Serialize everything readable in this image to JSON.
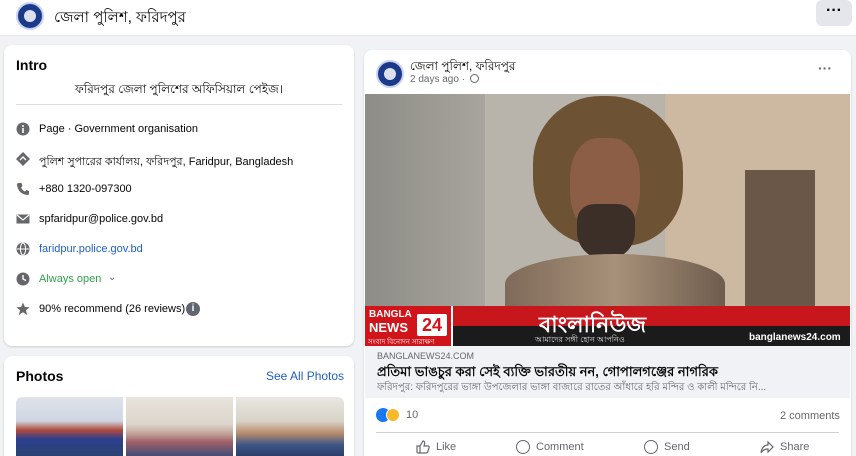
{
  "header": {
    "page_name": "জেলা পুলিশ, ফরিদপুর",
    "more_label": "···"
  },
  "intro": {
    "title": "Intro",
    "bio": "ফরিদপুর জেলা পুলিশের অফিসিয়াল পেইজ।",
    "items": [
      {
        "icon": "info-icon",
        "text": "Page · Government organisation"
      },
      {
        "icon": "location-pin-icon",
        "text": "পুলিশ সুপারের কার্যালয়, ফরিদপুর, Faridpur, Bangladesh"
      },
      {
        "icon": "phone-icon",
        "text": "+880 1320-097300"
      },
      {
        "icon": "email-icon",
        "text": "spfaridpur@police.gov.bd"
      },
      {
        "icon": "globe-icon",
        "text": "faridpur.police.gov.bd"
      },
      {
        "icon": "clock-icon",
        "text": "Always open",
        "chevron": "⌄"
      },
      {
        "icon": "star-icon",
        "text": "90% recommend (26 reviews)",
        "badge": "i"
      }
    ]
  },
  "photos": {
    "title": "Photos",
    "see_all": "See All Photos"
  },
  "post": {
    "author": "জেলা পুলিশ, ফরিদপুর",
    "time": "2 days ago ·",
    "more_label": "···",
    "image": {
      "brand_line1": "BANGLA",
      "brand_line2": "NEWS",
      "brand_number": "24",
      "brand_tagline": "সংবাদ বিনোদন সারাক্ষণ",
      "ticker_text": "বাংলানিউজ",
      "ticker_sub": "আমাদের সঙ্গী হোন আপনিও",
      "watermark": "banglanews24.com",
      "info_label": "i"
    },
    "link": {
      "domain": "BANGLANEWS24.COM",
      "headline": "প্রতিমা ভাঙচুর করা সেই ব্যক্তি ভারতীয় নন, গোপালগঞ্জের নাগরিক",
      "snippet": "ফরিদপুর: ফরিদপুরের ভাঙ্গা উপজেলার ভাঙ্গা বাজারে রাতের আঁধারে হরি মন্দির ও কালী মন্দিরে নি..."
    },
    "reactions_count": "10",
    "comments": "2 comments",
    "actions": {
      "like": "Like",
      "comment": "Comment",
      "send": "Send",
      "share": "Share"
    }
  },
  "colors": {
    "accent": "#1877f2",
    "link": "#1f5fc9",
    "open_status": "#31a24c",
    "ticker_red": "#c8161d"
  }
}
